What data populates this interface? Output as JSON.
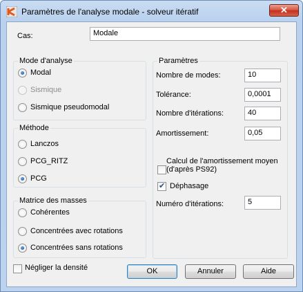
{
  "window": {
    "title": "Paramètres de l'analyse modale - solveur itératif",
    "close_label": "✕"
  },
  "case": {
    "label": "Cas:",
    "value": "Modale"
  },
  "analysis_mode": {
    "title": "Mode d'analyse",
    "options": [
      {
        "label": "Modal",
        "checked": true,
        "enabled": true
      },
      {
        "label": "Sismique",
        "checked": false,
        "enabled": false
      },
      {
        "label": "Sismique pseudomodal",
        "checked": false,
        "enabled": true
      }
    ]
  },
  "method": {
    "title": "Méthode",
    "options": [
      {
        "label": "Lanczos",
        "checked": false
      },
      {
        "label": "PCG_RITZ",
        "checked": false
      },
      {
        "label": "PCG",
        "checked": true
      }
    ]
  },
  "mass_matrix": {
    "title": "Matrice des masses",
    "options": [
      {
        "label": "Cohérentes",
        "checked": false
      },
      {
        "label": "Concentrées avec rotations",
        "checked": false
      },
      {
        "label": "Concentrées sans rotations",
        "checked": true
      }
    ]
  },
  "parameters": {
    "title": "Paramètres",
    "fields": [
      {
        "label": "Nombre de modes:",
        "value": "10"
      },
      {
        "label": "Tolérance:",
        "value": "0,0001"
      },
      {
        "label": "Nombre d'itérations:",
        "value": "40"
      },
      {
        "label": "Amortissement:",
        "value": "0,05"
      }
    ],
    "damping_calc": {
      "label_line1": "Calcul de l'amortissement moyen",
      "label_line2": "(d'après PS92)",
      "checked": false
    },
    "phase_shift": {
      "label": "Déphasage",
      "checked": true
    },
    "iteration_number": {
      "label": "Numéro d'itérations:",
      "value": "5"
    }
  },
  "ignore_density": {
    "label": "Négliger la densité",
    "checked": false
  },
  "buttons": {
    "ok": "OK",
    "cancel": "Annuler",
    "help": "Aide"
  }
}
